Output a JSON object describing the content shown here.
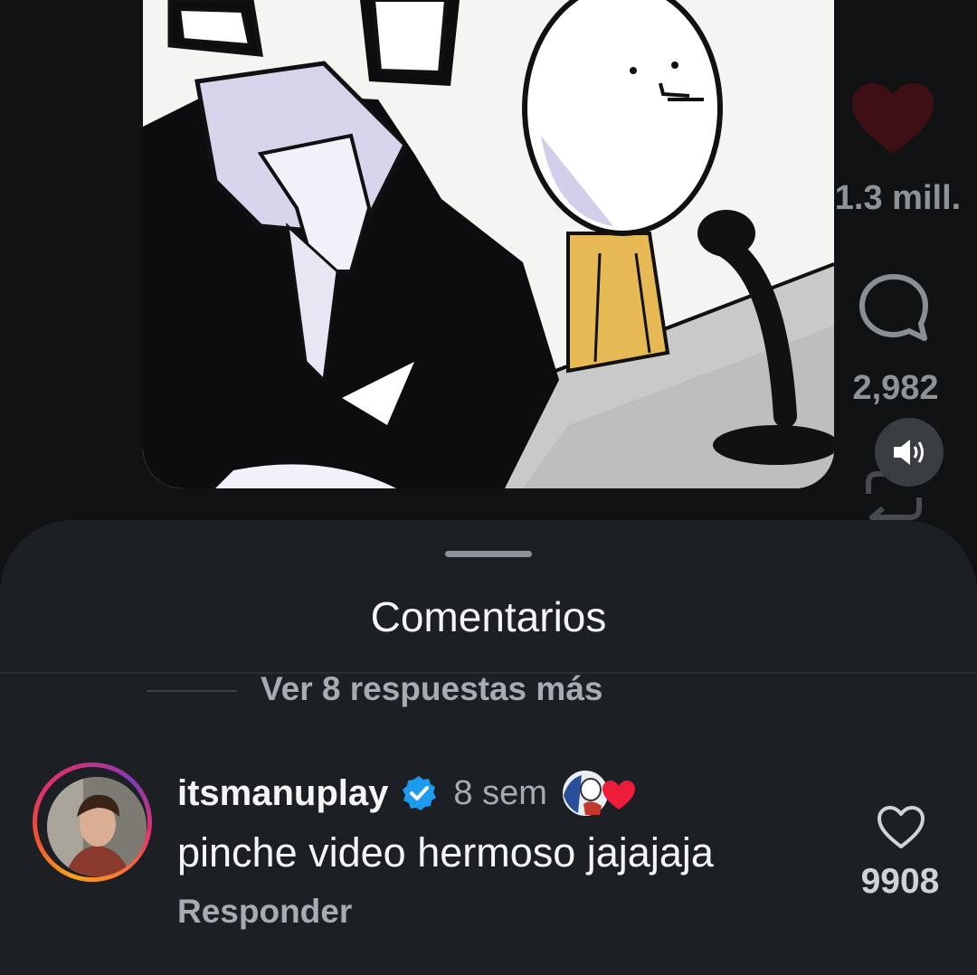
{
  "reel": {
    "like_count": "1.3 mill.",
    "comment_count": "2,982",
    "colors": {
      "like": "#ed1c3a",
      "background": "#101214"
    }
  },
  "comments_sheet": {
    "title": "Comentarios",
    "view_more_replies": "Ver 8 respuestas más",
    "comment": {
      "username": "itsmanuplay",
      "verified": true,
      "time": "8 sem",
      "text": "pinche video hermoso jajajaja",
      "reply_label": "Responder",
      "like_count": "9908",
      "liked_by_creator": true
    },
    "colors": {
      "sheet": "#1c1f24",
      "secondary_text": "#a7acb3",
      "verified": "#1d9bf0"
    }
  },
  "icons": [
    "heart-icon",
    "comment-bubble-icon",
    "volume-icon",
    "repost-icon",
    "verified-badge-icon",
    "heart-outline-icon",
    "creator-heart-icon"
  ]
}
